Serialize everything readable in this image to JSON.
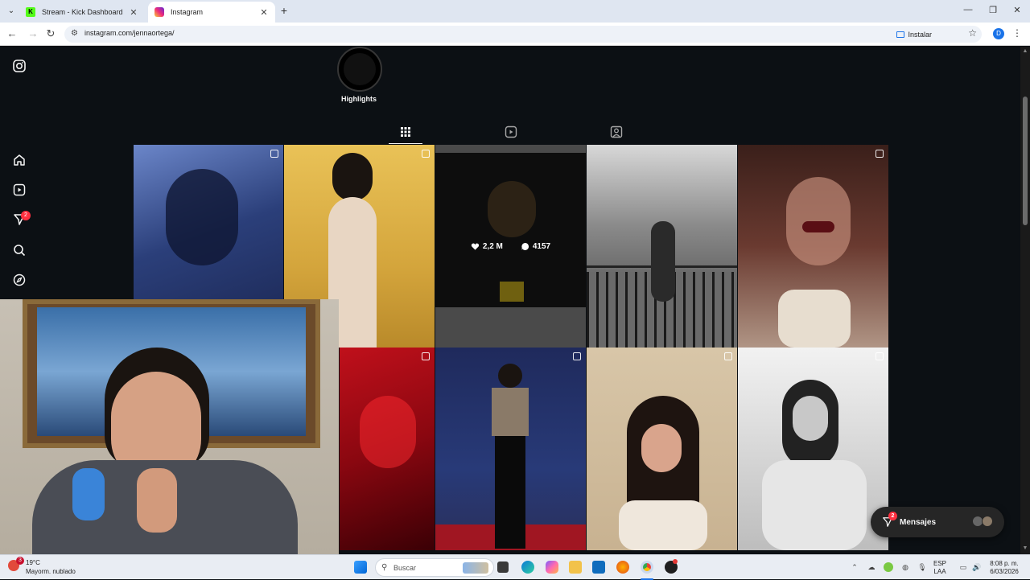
{
  "browser": {
    "tabs": [
      {
        "label": "Stream - Kick Dashboard",
        "icon": "kick-icon",
        "active": false
      },
      {
        "label": "Instagram",
        "icon": "instagram-icon",
        "active": true
      }
    ],
    "url": "instagram.com/jennaortega/",
    "install_label": "Instalar",
    "profile_initial": "D"
  },
  "instagram": {
    "notifications_badge": "2",
    "highlight_label": "Highlights",
    "hover_stats": {
      "likes": "2,2 M",
      "comments": "4157"
    },
    "messages_label": "Mensajes",
    "messages_badge": "2"
  },
  "taskbar": {
    "weather_temp": "19°C",
    "weather_desc": "Mayorm. nublado",
    "weather_badge": "3",
    "search_placeholder": "Buscar",
    "lang_top": "ESP",
    "lang_bottom": "LAA",
    "time": "8:08 p. m.",
    "date": "6/03/2026"
  },
  "colors": {
    "ig_background": "#0c1014",
    "badge_red": "#ff3040",
    "chrome_tabstrip": "#dfe6f1"
  }
}
